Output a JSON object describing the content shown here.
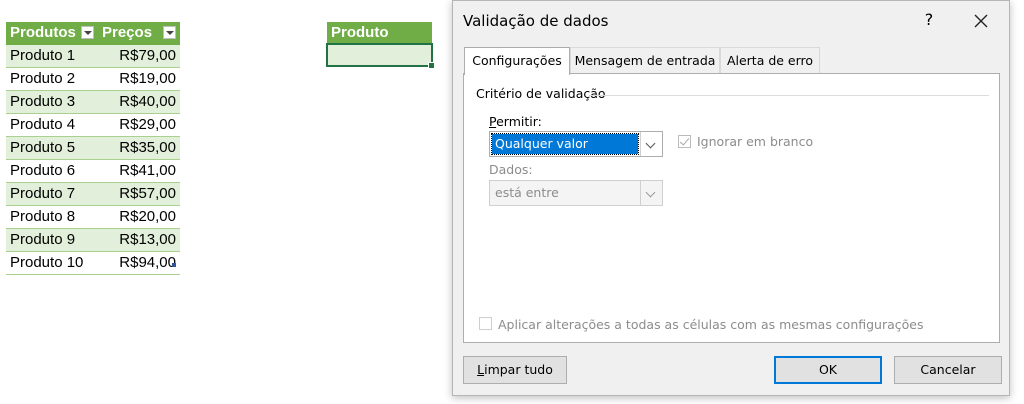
{
  "table": {
    "headers": [
      "Produtos",
      "Preços"
    ],
    "rows": [
      [
        "Produto 1",
        "R$79,00"
      ],
      [
        "Produto 2",
        "R$19,00"
      ],
      [
        "Produto 3",
        "R$40,00"
      ],
      [
        "Produto 4",
        "R$29,00"
      ],
      [
        "Produto 5",
        "R$35,00"
      ],
      [
        "Produto 6",
        "R$41,00"
      ],
      [
        "Produto 7",
        "R$57,00"
      ],
      [
        "Produto 8",
        "R$20,00"
      ],
      [
        "Produto 9",
        "R$13,00"
      ],
      [
        "Produto 10",
        "R$94,00"
      ]
    ]
  },
  "produto_header": "Produto",
  "dialog": {
    "title": "Validação de dados",
    "help": "?",
    "tabs": [
      "Configurações",
      "Mensagem de entrada",
      "Alerta de erro"
    ],
    "group_label": "Critério de validação",
    "permitir_label": "Permitir:",
    "permitir_value": "Qualquer valor",
    "ignorar_label": "Ignorar em branco",
    "dados_label": "Dados:",
    "dados_value": "está entre",
    "apply_all_label": "Aplicar alterações a todas as células com as mesmas configurações",
    "clear_button": "Limpar tudo",
    "ok_button": "OK",
    "cancel_button": "Cancelar"
  },
  "colors": {
    "table_header": "#70ad47",
    "table_band": "#e2efda",
    "selection": "#0078d7"
  }
}
